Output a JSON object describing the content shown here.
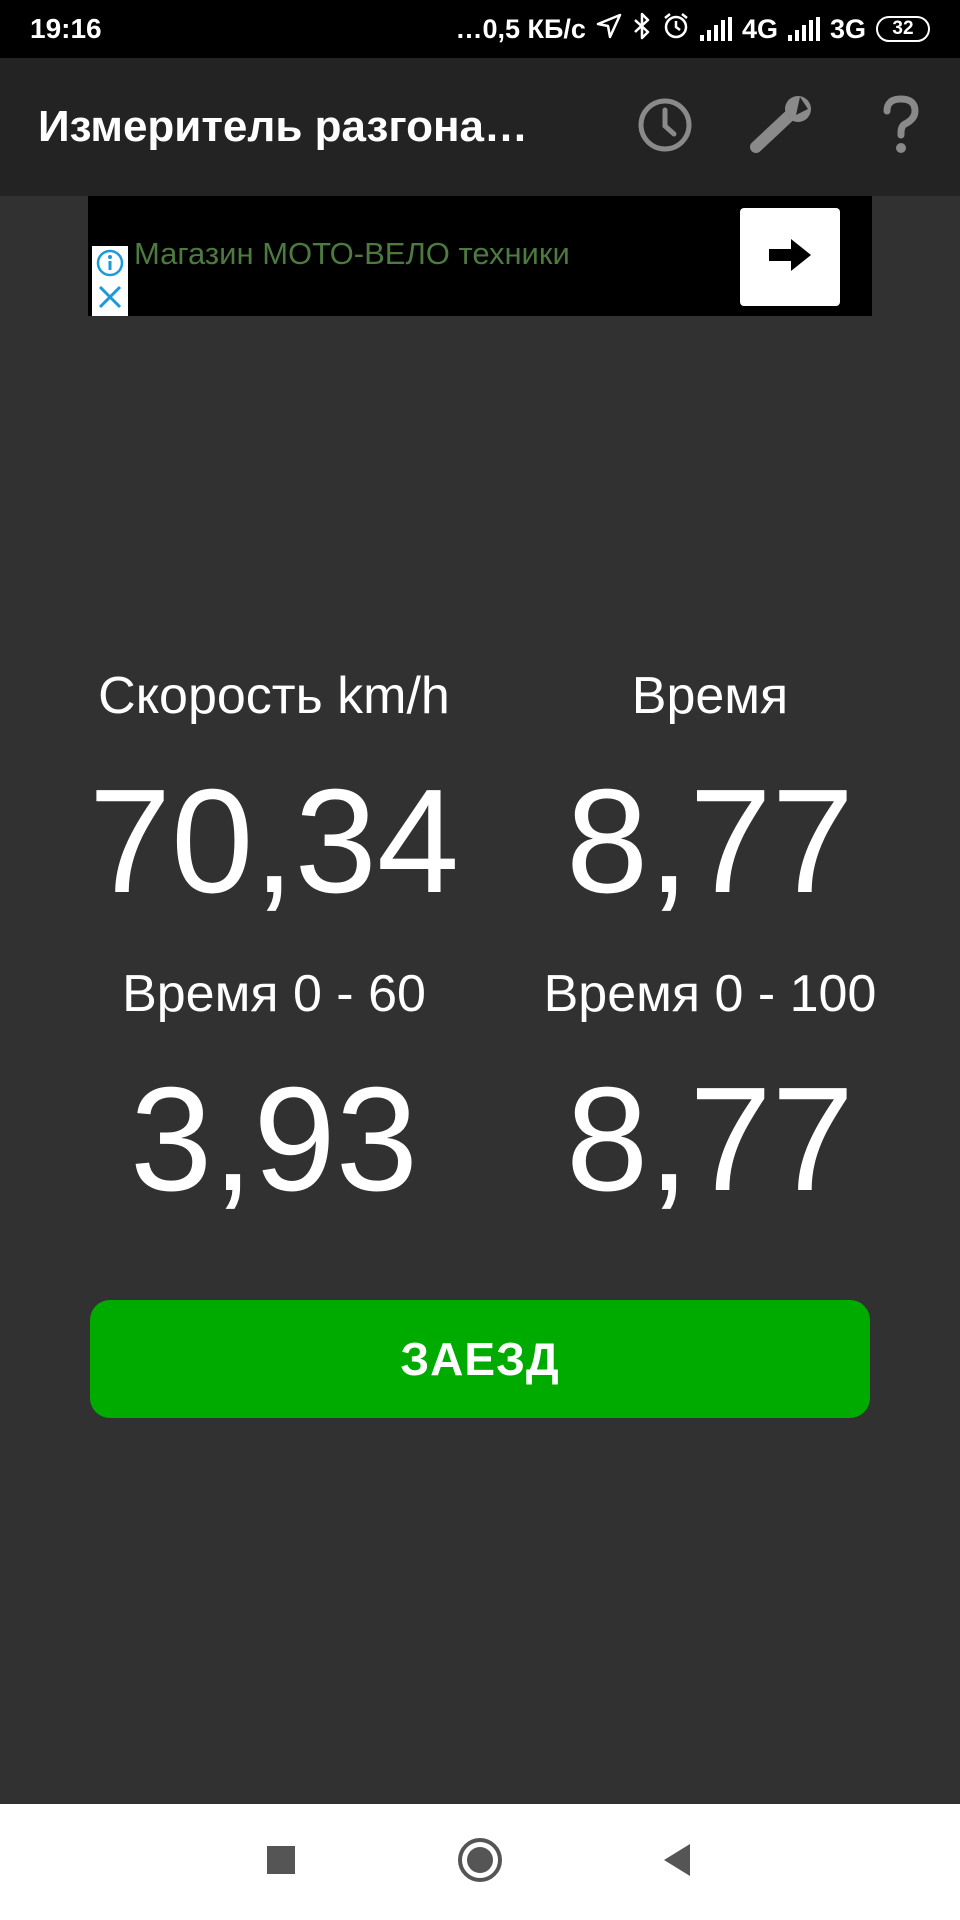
{
  "status_bar": {
    "time": "19:16",
    "net_speed": "…0,5 КБ/с",
    "net1": "4G",
    "net2": "3G",
    "battery": "32",
    "icons": [
      "location-icon",
      "bluetooth-icon",
      "alarm-icon",
      "signal-icon",
      "signal-icon"
    ]
  },
  "app_bar": {
    "title": "Измеритель разгона…",
    "actions": [
      "history-clock-icon",
      "wrench-settings-icon",
      "help-question-icon"
    ]
  },
  "ad": {
    "text": "Магазин МОТО-ВЕЛО техники",
    "icons": [
      "info-icon",
      "close-icon",
      "arrow-right-icon"
    ]
  },
  "stats": {
    "speed_label": "Скорость km/h",
    "speed_value": "70,34",
    "time_label": "Время",
    "time_value": "8,77",
    "time60_label": "Время 0 - 60",
    "time60_value": "3,93",
    "time100_label": "Время 0 - 100",
    "time100_value": "8,77"
  },
  "run_button": {
    "label": "ЗАЕЗД",
    "color": "#00ab00"
  },
  "nav_bar": {
    "icons": [
      "recents-square-icon",
      "home-circle-icon",
      "back-triangle-icon"
    ]
  }
}
